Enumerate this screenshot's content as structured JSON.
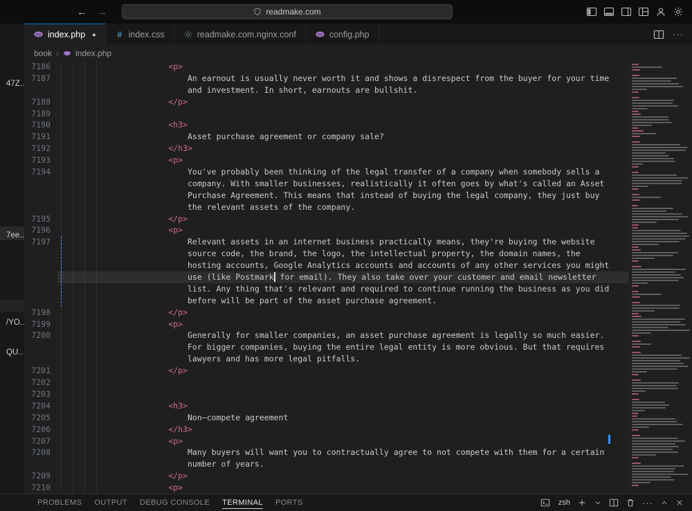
{
  "title_bar": {
    "back_glyph": "←",
    "forward_glyph": "→",
    "url": "readmake.com"
  },
  "tab_bar": {
    "modified_dot": "●",
    "tabs": [
      {
        "label": "index.php",
        "icon": "php-icon",
        "modified": true,
        "active": true
      },
      {
        "label": "index.css",
        "icon": "css-icon",
        "modified": false,
        "active": false
      },
      {
        "label": "readmake.com.nginx.conf",
        "icon": "conf-gear-icon",
        "modified": false,
        "active": false
      },
      {
        "label": "config.php",
        "icon": "php-icon",
        "modified": false,
        "active": false
      }
    ]
  },
  "breadcrumb": {
    "folder": "book",
    "separator": "›",
    "file": "index.php"
  },
  "sidebar": {
    "items": [
      {
        "label": "47Z…"
      },
      {
        "label": "7ee…"
      },
      {
        "label": "/YO…"
      },
      {
        "label": "QU…"
      }
    ]
  },
  "editor": {
    "colors": {
      "tag": "#d16d87",
      "text": "#cbcbcb",
      "line_number": "#6e7681",
      "active_guide": "#5aa7ff",
      "cursor": "#e6e6e6"
    },
    "lines": [
      {
        "num": "7186",
        "kind": "tag",
        "text": "<p>"
      },
      {
        "num": "7187",
        "kind": "text",
        "text": "An earnout is usually never worth it and shows a disrespect from the buyer for your time"
      },
      {
        "num": "",
        "kind": "text",
        "text": "and investment. In short, earnouts are bullshit."
      },
      {
        "num": "7188",
        "kind": "tag",
        "text": "</p>"
      },
      {
        "num": "7189",
        "kind": "blank",
        "text": ""
      },
      {
        "num": "7190",
        "kind": "tag",
        "text": "<h3>"
      },
      {
        "num": "7191",
        "kind": "text",
        "text": "Asset purchase agreement or company sale?"
      },
      {
        "num": "7192",
        "kind": "tag",
        "text": "</h3>"
      },
      {
        "num": "7193",
        "kind": "tag",
        "text": "<p>"
      },
      {
        "num": "7194",
        "kind": "text",
        "text": "You've probably been thinking of the legal transfer of a company when somebody sells a"
      },
      {
        "num": "",
        "kind": "text",
        "text": "company. With smaller businesses, realistically it often goes by what's called an Asset"
      },
      {
        "num": "",
        "kind": "text",
        "text": "Purchase Agreement. This means that instead of buying the legal company, they just buy"
      },
      {
        "num": "",
        "kind": "text",
        "text": "the relevant assets of the company."
      },
      {
        "num": "7195",
        "kind": "tag",
        "text": "</p>"
      },
      {
        "num": "7196",
        "kind": "tag",
        "text": "<p>"
      },
      {
        "num": "7197",
        "kind": "text",
        "text": "Relevant assets in an internet business practically means, they're buying the website"
      },
      {
        "num": "",
        "kind": "text",
        "text": "source code, the brand, the logo, the intellectual property, the domain names, the"
      },
      {
        "num": "",
        "kind": "text",
        "text": "hosting accounts, Google Analytics accounts and accounts of any other services you might"
      },
      {
        "num": "",
        "kind": "cursor",
        "current": true,
        "before": "use (like Postmark",
        "after": " for email). They also take over your customer and email newsletter"
      },
      {
        "num": "",
        "kind": "text",
        "text": "list. Any thing that's relevant and required to continue running the business as you did"
      },
      {
        "num": "",
        "kind": "text",
        "text": "before will be part of the asset purchase agreement."
      },
      {
        "num": "7198",
        "kind": "tag",
        "text": "</p>"
      },
      {
        "num": "7199",
        "kind": "tag",
        "text": "<p>"
      },
      {
        "num": "7200",
        "kind": "text",
        "text": "Generally for smaller companies, an asset purchase agreement is legally so much easier."
      },
      {
        "num": "",
        "kind": "text",
        "text": "For bigger companies, buying the entire legal entity is more obvious. But that requires"
      },
      {
        "num": "",
        "kind": "text",
        "text": "lawyers and has more legal pitfalls."
      },
      {
        "num": "7201",
        "kind": "tag",
        "text": "</p>"
      },
      {
        "num": "7202",
        "kind": "blank",
        "text": ""
      },
      {
        "num": "7203",
        "kind": "blank",
        "text": ""
      },
      {
        "num": "7204",
        "kind": "tag",
        "text": "<h3>"
      },
      {
        "num": "7205",
        "kind": "text",
        "text": "Non—compete agreement"
      },
      {
        "num": "7206",
        "kind": "tag",
        "text": "</h3>"
      },
      {
        "num": "7207",
        "kind": "tag",
        "text": "<p>"
      },
      {
        "num": "7208",
        "kind": "text",
        "text": "Many buyers will want you to contractually agree to not compete with them for a certain"
      },
      {
        "num": "",
        "kind": "text",
        "text": "number of years."
      },
      {
        "num": "7209",
        "kind": "tag",
        "text": "</p>"
      },
      {
        "num": "7210",
        "kind": "tag",
        "text": "<p>"
      }
    ]
  },
  "panel": {
    "tabs": [
      {
        "label": "PROBLEMS"
      },
      {
        "label": "OUTPUT"
      },
      {
        "label": "DEBUG CONSOLE"
      },
      {
        "label": "TERMINAL",
        "active": true
      },
      {
        "label": "PORTS"
      }
    ],
    "shell_label": "zsh"
  }
}
